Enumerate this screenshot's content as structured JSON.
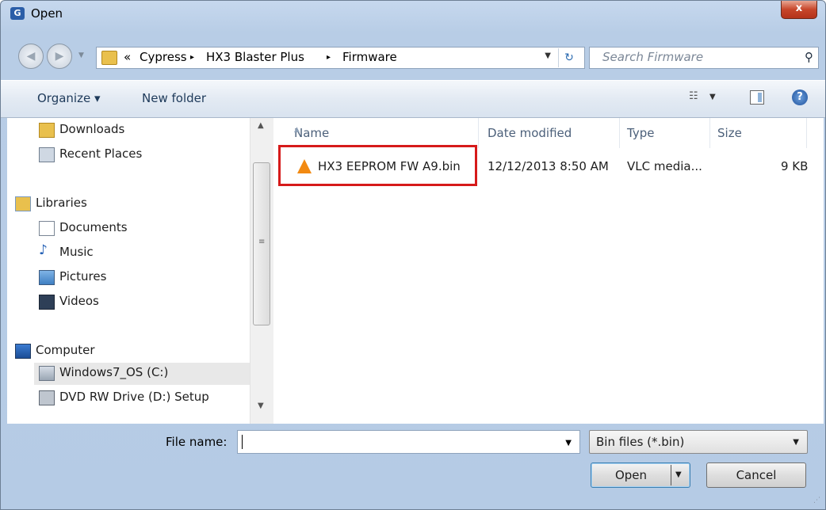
{
  "window": {
    "title": "Open",
    "close_label": "x"
  },
  "address": {
    "overflow": "«",
    "crumbs": [
      "Cypress",
      "HX3 Blaster Plus",
      "Firmware"
    ],
    "separator": "▸",
    "search_placeholder": "Search Firmware"
  },
  "toolbar": {
    "organize": "Organize ▾",
    "new_folder": "New folder"
  },
  "nav": {
    "items": [
      {
        "label": "Downloads",
        "icon": "downloads-icon"
      },
      {
        "label": "Recent Places",
        "icon": "recent-places-icon"
      },
      {
        "label": "Libraries",
        "icon": "libraries-icon"
      },
      {
        "label": "Documents",
        "icon": "documents-icon"
      },
      {
        "label": "Music",
        "icon": "music-icon"
      },
      {
        "label": "Pictures",
        "icon": "pictures-icon"
      },
      {
        "label": "Videos",
        "icon": "videos-icon"
      },
      {
        "label": "Computer",
        "icon": "computer-icon"
      },
      {
        "label": "Windows7_OS (C:)",
        "icon": "drive-icon",
        "selected": true
      },
      {
        "label": "DVD RW Drive (D:) Setup",
        "icon": "dvd-drive-icon"
      }
    ]
  },
  "columns": [
    "Name",
    "Date modified",
    "Type",
    "Size"
  ],
  "files": [
    {
      "name": "HX3 EEPROM FW A9.bin",
      "date": "12/12/2013 8:50 AM",
      "type": "VLC media...",
      "size": "9 KB"
    }
  ],
  "bottom": {
    "file_name_label": "File name:",
    "file_name_value": "",
    "filter": "Bin files (*.bin)",
    "open": "Open",
    "cancel": "Cancel"
  },
  "colors": {
    "highlight": "#d61a1a",
    "vlc_orange": "#f28a12"
  }
}
